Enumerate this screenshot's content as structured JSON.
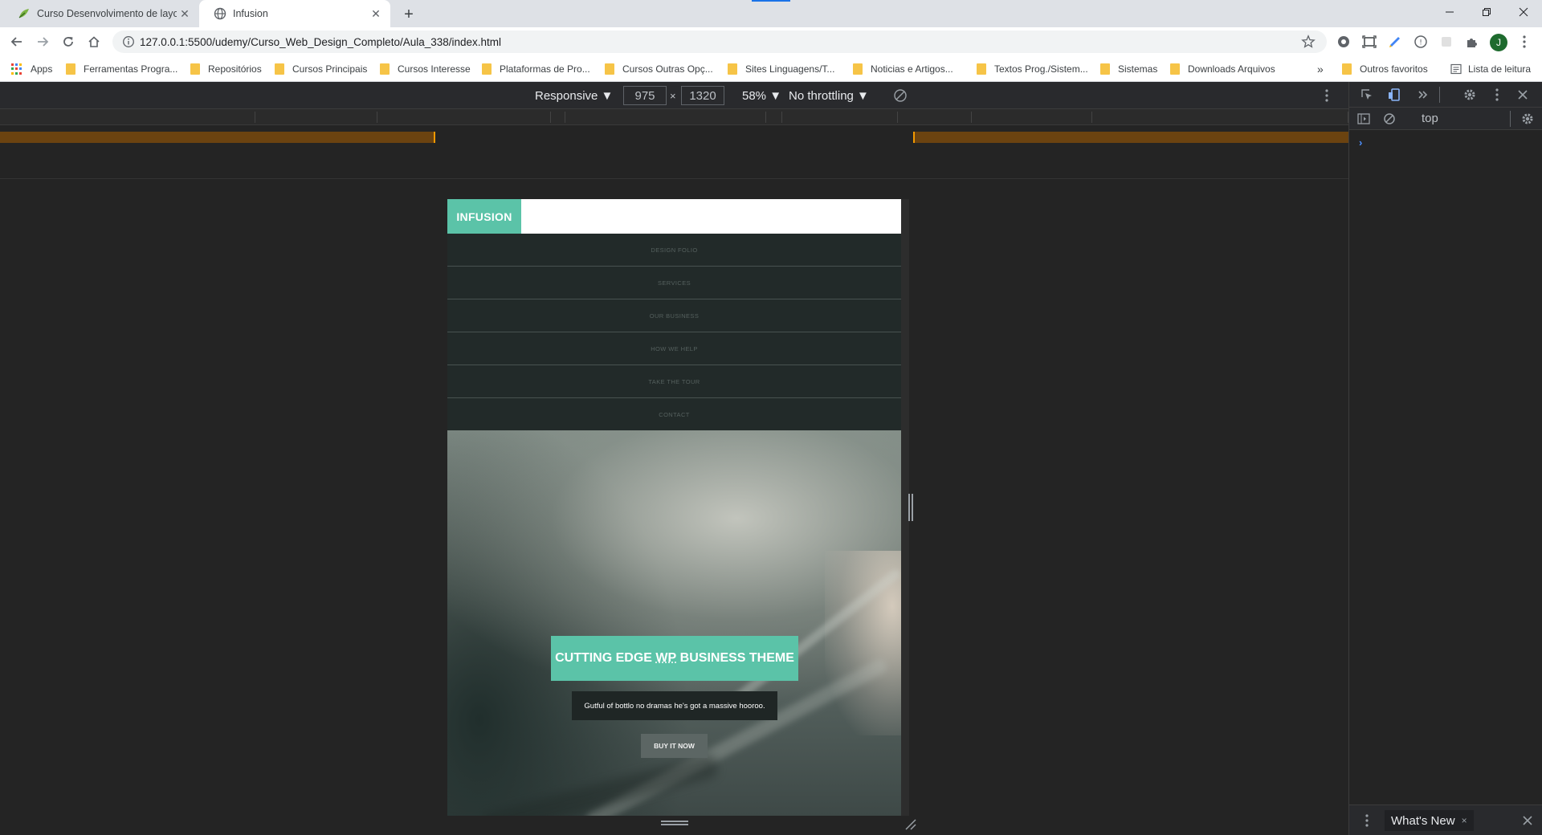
{
  "browser": {
    "tabs": [
      {
        "title": "Curso Desenvolvimento de layou",
        "active": false
      },
      {
        "title": "Infusion",
        "active": true
      }
    ],
    "url": "127.0.0.1:5500/udemy/Curso_Web_Design_Completo/Aula_338/index.html",
    "profile_initial": "J",
    "bookmarks": [
      "Apps",
      "Ferramentas Progra...",
      "Repositórios",
      "Cursos Principais",
      "Cursos Interesse",
      "Plataformas de Pro...",
      "Cursos Outras Opç...",
      "Sites Linguagens/T...",
      "Noticias e Artigos...",
      "Textos Prog./Sistem...",
      "Sistemas",
      "Downloads Arquivos"
    ],
    "bookmarks_overflow": "»",
    "other_bookmarks": "Outros favoritos",
    "reading_list": "Lista de leitura",
    "colors": {
      "accent": "#1a73e8",
      "folder": "#f6c447"
    }
  },
  "device_toolbar": {
    "mode": "Responsive ▼",
    "width": "975",
    "times": "×",
    "height": "1320",
    "zoom": "58% ▼",
    "throttling": "No throttling ▼"
  },
  "page": {
    "logo": "INFUSION",
    "nav": [
      "DESIGN FOLIO",
      "SERVICES",
      "OUR BUSINESS",
      "HOW WE HELP",
      "TAKE THE TOUR",
      "CONTACT"
    ],
    "hero": {
      "title_before": "CUTTING EDGE ",
      "title_wp": "WP",
      "title_after": " BUSINESS THEME",
      "subtitle": "Gutful of bottlo no dramas he's got a massive hooroo.",
      "button": "BUY IT NOW"
    },
    "colors": {
      "brand": "#5bc3a8",
      "nav_bg": "#222a29"
    }
  },
  "devtools": {
    "context": "top",
    "prompt": "›",
    "drawer_tab": "What's New",
    "drawer_close": "×"
  }
}
